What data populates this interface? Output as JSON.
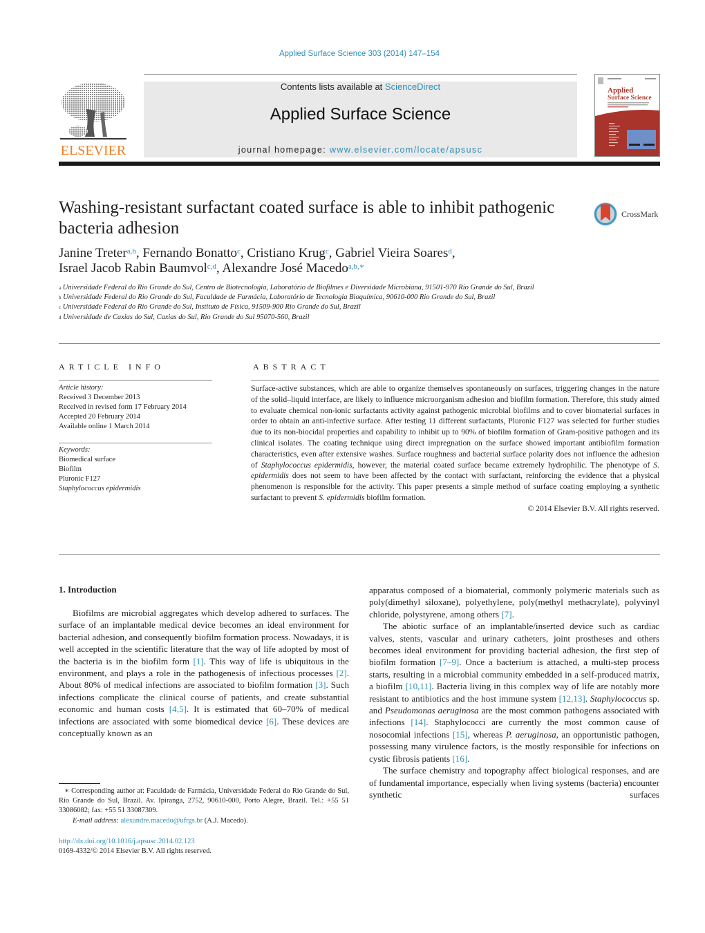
{
  "header": {
    "citation": "Applied Surface Science 303 (2014) 147–154",
    "contents_prefix": "Contents lists available at ",
    "contents_link": "ScienceDirect",
    "journal_title": "Applied Surface Science",
    "homepage_prefix": "journal homepage: ",
    "homepage_link": "www.elsevier.com/locate/apsusc",
    "publisher_logo_text": "ELSEVIER",
    "cover_title_line1": "Applied",
    "cover_title_line2": "Surface Science",
    "crossmark_label": "CrossMark"
  },
  "article": {
    "title": "Washing-resistant surfactant coated surface is able to inhibit pathogenic bacteria adhesion",
    "authors": [
      {
        "name": "Janine Treter",
        "sup": "a,b",
        "sep": ", "
      },
      {
        "name": "Fernando Bonatto",
        "sup": "c",
        "sep": ", "
      },
      {
        "name": "Cristiano Krug",
        "sup": "c",
        "sep": ", "
      },
      {
        "name": "Gabriel Vieira Soares",
        "sup": "d",
        "sep": ","
      },
      {
        "name": "Israel Jacob Rabin Baumvol",
        "sup": "c,d",
        "sep": ", "
      },
      {
        "name": "Alexandre José Macedo",
        "sup": "a,b,∗",
        "sep": ""
      }
    ],
    "affiliations": [
      {
        "key": "a",
        "text": "Universidade Federal do Rio Grande do Sul, Centro de Biotecnologia, Laboratório de Biofilmes e Diversidade Microbiana, 91501-970 Rio Grande do Sul, Brazil"
      },
      {
        "key": "b",
        "text": "Universidade Federal do Rio Grande do Sul, Faculdade de Farmácia, Laboratório de Tecnologia Bioquímica, 90610-000 Rio Grande do Sul, Brazil"
      },
      {
        "key": "c",
        "text": "Universidade Federal do Rio Grande do Sul, Instituto de Física, 91509-900 Rio Grande do Sul, Brazil"
      },
      {
        "key": "d",
        "text": "Universidade de Caxias do Sul, Caxias do Sul, Rio Grande do Sul 95070-560, Brazil"
      }
    ]
  },
  "article_info": {
    "heading": "ARTICLE INFO",
    "history_label": "Article history:",
    "history": [
      "Received 3 December 2013",
      "Received in revised form 17 February 2014",
      "Accepted 20 February 2014",
      "Available online 1 March 2014"
    ],
    "keywords_label": "Keywords:",
    "keywords": [
      "Biomedical surface",
      "Biofilm",
      "Pluronic F127",
      "Staphylococcus epidermidis"
    ]
  },
  "abstract": {
    "heading": "ABSTRACT",
    "p1": "Surface-active substances, which are able to organize themselves spontaneously on surfaces, triggering changes in the nature of the solid–liquid interface, are likely to influence microorganism adhesion and biofilm formation. Therefore, this study aimed to evaluate chemical non-ionic surfactants activity against pathogenic microbial biofilms and to cover biomaterial surfaces in order to obtain an anti-infective surface. After testing 11 different surfactants, Pluronic F127 was selected for further studies due to its non-biocidal properties and capability to inhibit up to 90% of biofilm formation of Gram-positive pathogen and its clinical isolates. The coating technique using direct impregnation on the surface showed important antibiofilm formation characteristics, even after extensive washes. Surface roughness and bacterial surface polarity does not influence the adhesion of ",
    "it1": "Staphylococcus epidermidis",
    "p2": ", however, the material coated surface became extremely hydrophilic. The phenotype of ",
    "it2": "S. epidermidis",
    "p3": " does not seem to have been affected by the contact with surfactant, reinforcing the evidence that a physical phenomenon is responsible for the activity. This paper presents a simple method of surface coating employing a synthetic surfactant to prevent ",
    "it3": "S. epidermidis",
    "p4": " biofilm formation.",
    "copyright": "© 2014 Elsevier B.V. All rights reserved."
  },
  "intro": {
    "heading": "1.  Introduction",
    "left_p1": [
      {
        "t": "Biofilms are microbial aggregates which develop adhered to surfaces. The surface of an implantable medical device becomes an ideal environment for bacterial adhesion, and consequently biofilm formation process. Nowadays, it is well accepted in the scientific literature that the way of life adopted by most of the bacteria is in the biofilm form "
      },
      {
        "ref": "[1]"
      },
      {
        "t": ". This way of life is ubiquitous in the environment, and plays a role in the pathogenesis of infectious processes "
      },
      {
        "ref": "[2]"
      },
      {
        "t": ". About 80% of medical infections are associated to biofilm formation "
      },
      {
        "ref": "[3]"
      },
      {
        "t": ". Such infections complicate the clinical course of patients, and create substantial economic and human costs "
      },
      {
        "ref": "[4,5]"
      },
      {
        "t": ". It is estimated that 60–70% of medical infections are associated with some biomedical device "
      },
      {
        "ref": "[6]"
      },
      {
        "t": ". These devices are conceptually known as an"
      }
    ],
    "right_p0": [
      {
        "t": "apparatus composed of a biomaterial, commonly polymeric materials such as poly(dimethyl siloxane), polyethylene, poly(methyl methacrylate), polyvinyl chloride, polystyrene, among others "
      },
      {
        "ref": "[7]"
      },
      {
        "t": "."
      }
    ],
    "right_p1": [
      {
        "t": "The abiotic surface of an implantable/inserted device such as cardiac valves, stents, vascular and urinary catheters, joint prostheses and others becomes ideal environment for providing bacterial adhesion, the first step of biofilm formation "
      },
      {
        "ref": "[7–9]"
      },
      {
        "t": ". Once a bacterium is attached, a multi-step process starts, resulting in a microbial community embedded in a self-produced matrix, a biofilm "
      },
      {
        "ref": "[10,11]"
      },
      {
        "t": ". Bacteria living in this complex way of life are notably more resistant to antibiotics and the host immune system "
      },
      {
        "ref": "[12,13]"
      },
      {
        "t": ". "
      },
      {
        "i": "Staphylococcus"
      },
      {
        "t": " sp. and "
      },
      {
        "i": "Pseudomonas aeruginosa"
      },
      {
        "t": " are the most common pathogens associated with infections "
      },
      {
        "ref": "[14]"
      },
      {
        "t": ". Staphylococci are currently the most common cause of nosocomial infections "
      },
      {
        "ref": "[15]"
      },
      {
        "t": ", whereas "
      },
      {
        "i": "P. aeruginosa"
      },
      {
        "t": ", an opportunistic pathogen, possessing many virulence factors, is the mostly responsible for infections on cystic fibrosis patients "
      },
      {
        "ref": "[16]"
      },
      {
        "t": "."
      }
    ],
    "right_p2": [
      {
        "t": "The surface chemistry and topography affect biological responses, and are of fundamental importance, especially when living systems (bacteria) encounter synthetic surfaces"
      }
    ]
  },
  "footnote": {
    "corresponding": "∗  Corresponding author at: Faculdade de Farmácia, Universidade Federal do Rio Grande do Sul, Rio Grande do Sul, Brazil. Av. Ipiranga, 2752, 90610-000, Porto Alegre, Brazil. Tel.: +55 51 33086082; fax: +55 51 33087309.",
    "email_label": "E-mail address:",
    "email": "alexandre.macedo@ufrgs.br",
    "email_suffix": " (A.J. Macedo).",
    "doi": "http://dx.doi.org/10.1016/j.apsusc.2014.02.123",
    "issn": "0169-4332/© 2014 Elsevier B.V. All rights reserved."
  },
  "colors": {
    "link": "#2f8fb5",
    "elsevier_orange": "#f07f22",
    "cover_red": "#a8342c",
    "crossmark_red": "#d9442f"
  }
}
